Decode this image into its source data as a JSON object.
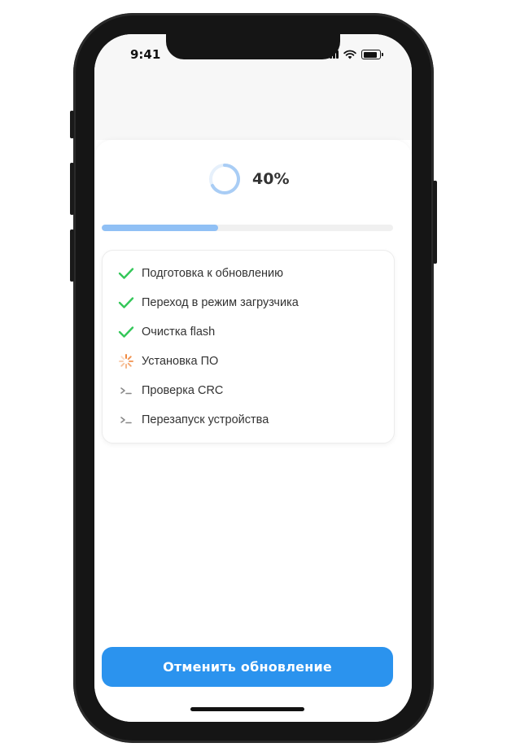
{
  "status_bar": {
    "time": "9:41"
  },
  "progress": {
    "percent_label": "40%",
    "value": 0.4
  },
  "steps": [
    {
      "label": "Подготовка к обновлению",
      "state": "done",
      "icon": "check-icon"
    },
    {
      "label": "Переход в режим загрузчика",
      "state": "done",
      "icon": "check-icon"
    },
    {
      "label": "Очистка flash",
      "state": "done",
      "icon": "check-icon"
    },
    {
      "label": "Установка ПО",
      "state": "in-progress",
      "icon": "spinner-icon"
    },
    {
      "label": "Проверка CRC",
      "state": "pending",
      "icon": "terminal-icon"
    },
    {
      "label": "Перезапуск устройства",
      "state": "pending",
      "icon": "terminal-icon"
    }
  ],
  "cancel_button": {
    "label": "Отменить обновление"
  },
  "colors": {
    "accent": "#2b93ee",
    "progress_fill": "#90c0f5",
    "done": "#34c759",
    "spinner": "#f0883e"
  }
}
